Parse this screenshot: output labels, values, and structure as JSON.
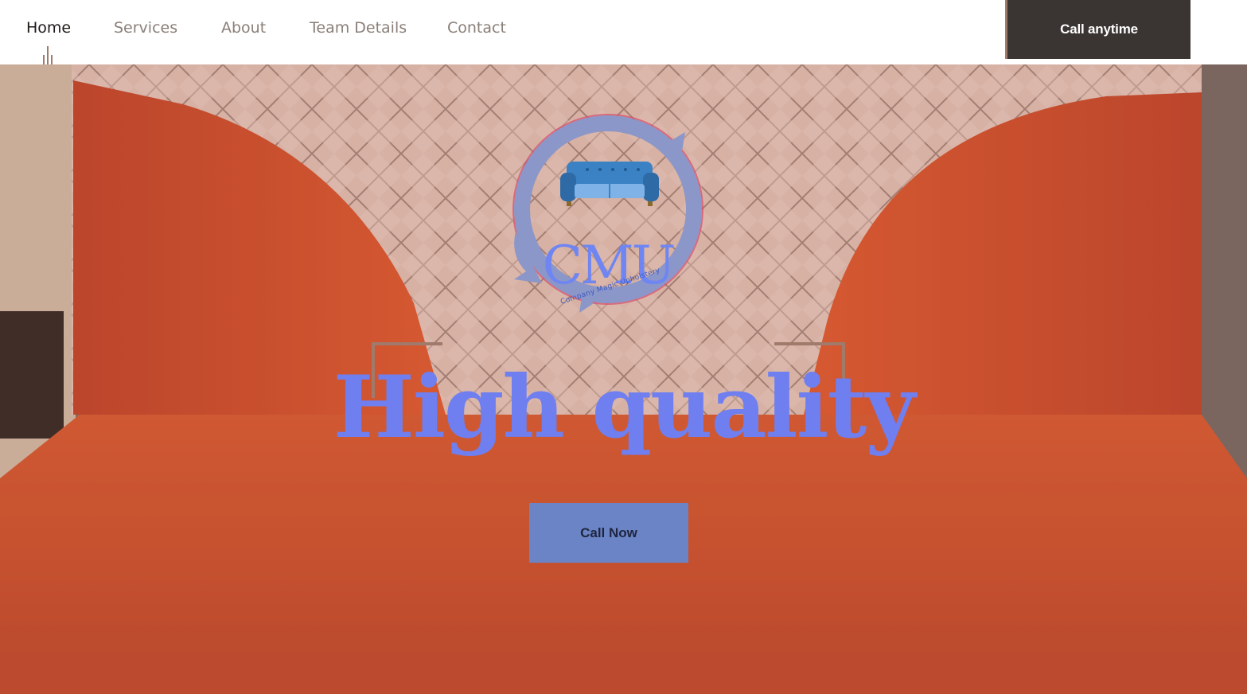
{
  "nav": {
    "items": [
      {
        "label": "Home",
        "active": true
      },
      {
        "label": "Services",
        "active": false
      },
      {
        "label": "About",
        "active": false
      },
      {
        "label": "Team Details",
        "active": false
      },
      {
        "label": "Contact",
        "active": false
      }
    ],
    "cta_label": "Call anytime"
  },
  "hero": {
    "logo": {
      "monogram": "CMU",
      "tagline": "Company Magic Upholstery",
      "icon": "sofa-icon"
    },
    "headline": "High quality",
    "cta_label": "Call Now",
    "background": "red-leather-booth-with-quilted-backrest"
  },
  "colors": {
    "nav_bg": "#ffffff",
    "nav_text": "#8a7f78",
    "nav_active": "#1e1a18",
    "accent_brown": "#a07a6a",
    "top_cta_bg": "#3a3432",
    "headline": "#6f7ff0",
    "hero_cta_bg": "#6b84c5",
    "leather": "#c9522f"
  }
}
